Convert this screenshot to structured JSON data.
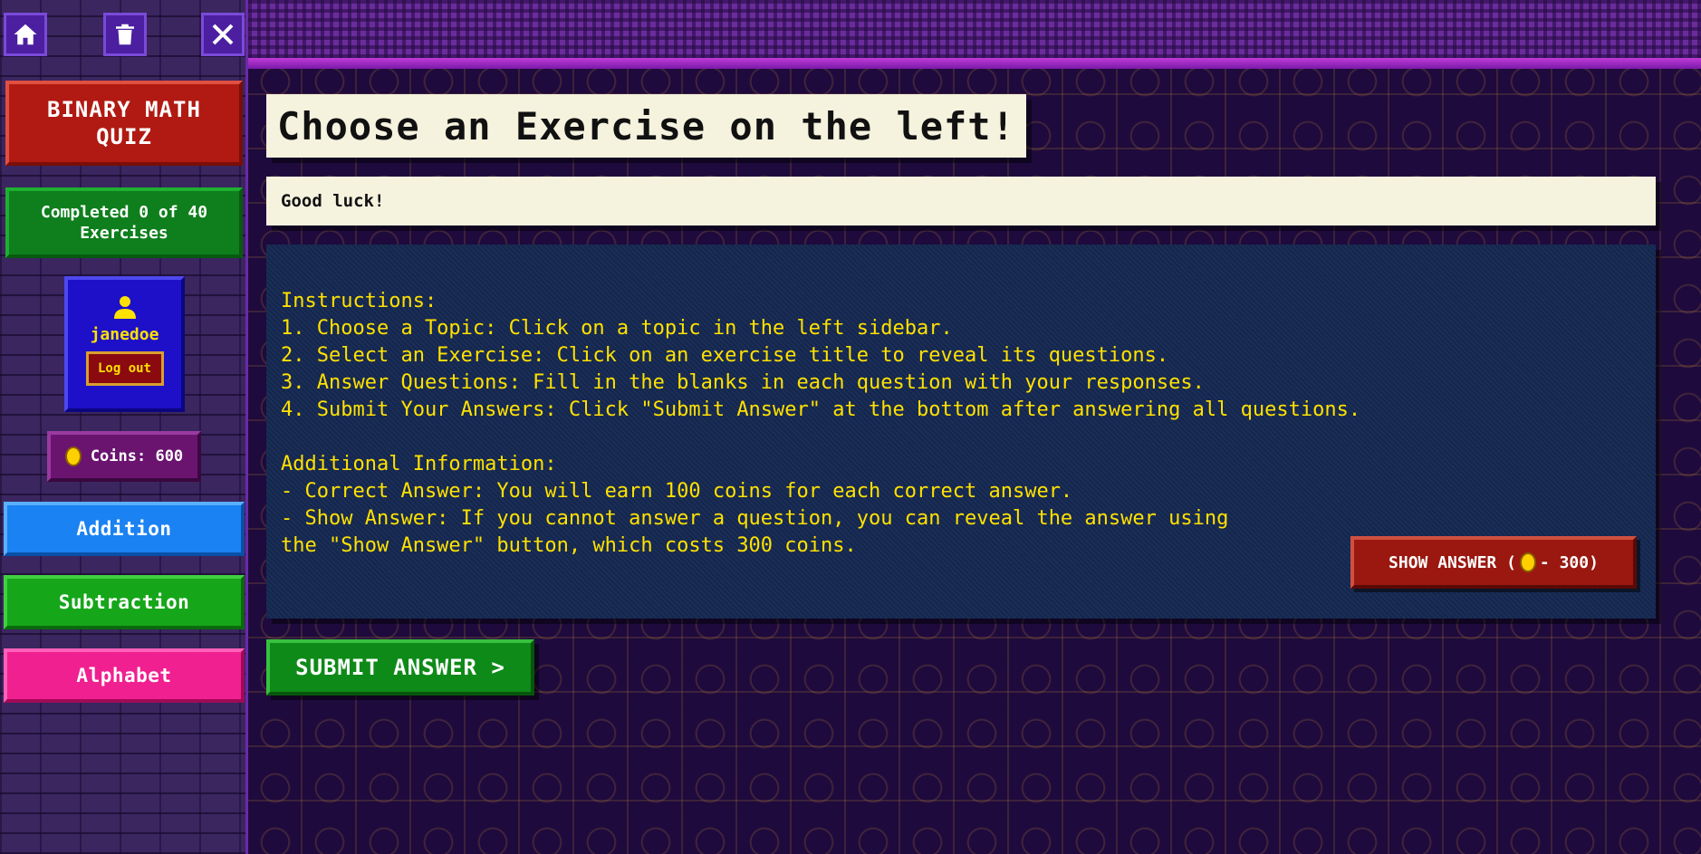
{
  "toolbar": {
    "home_icon": "home-icon",
    "trash_icon": "trash-icon",
    "close_icon": "close-icon"
  },
  "sidebar": {
    "title": "BINARY MATH QUIZ",
    "progress": "Completed 0 of 40 Exercises",
    "user": {
      "username": "janedoe",
      "logout_label": "Log out"
    },
    "coins_label": "Coins: 600",
    "topics": [
      {
        "label": "Addition",
        "color": "#1a82f2"
      },
      {
        "label": "Subtraction",
        "color": "#16a61a"
      },
      {
        "label": "Alphabet",
        "color": "#f02090"
      }
    ]
  },
  "main": {
    "heading": "Choose an Exercise on the left!",
    "luck_message": "Good luck!",
    "instructions": [
      "Instructions:",
      "1. Choose a Topic: Click on a topic in the left sidebar.",
      "2. Select an Exercise: Click on an exercise title to reveal its questions.",
      "3. Answer Questions: Fill in the blanks in each question with your responses.",
      "4. Submit Your Answers: Click \"Submit Answer\" at the bottom after answering all questions."
    ],
    "additional": [
      "Additional Information:",
      "- Correct Answer: You will earn 100 coins for each correct answer.",
      "- Show Answer: If you cannot answer a question, you can reveal the answer using",
      "the \"Show Answer\" button, which costs 300 coins."
    ],
    "show_answer": {
      "label_prefix": "SHOW ANSWER (",
      "label_suffix": "- 300)"
    },
    "submit_label": "SUBMIT ANSWER >"
  },
  "colors": {
    "accent_yellow": "#ffe100",
    "title_red": "#b01a12",
    "progress_green": "#0e7f1c",
    "user_blue": "#1d10c8"
  }
}
